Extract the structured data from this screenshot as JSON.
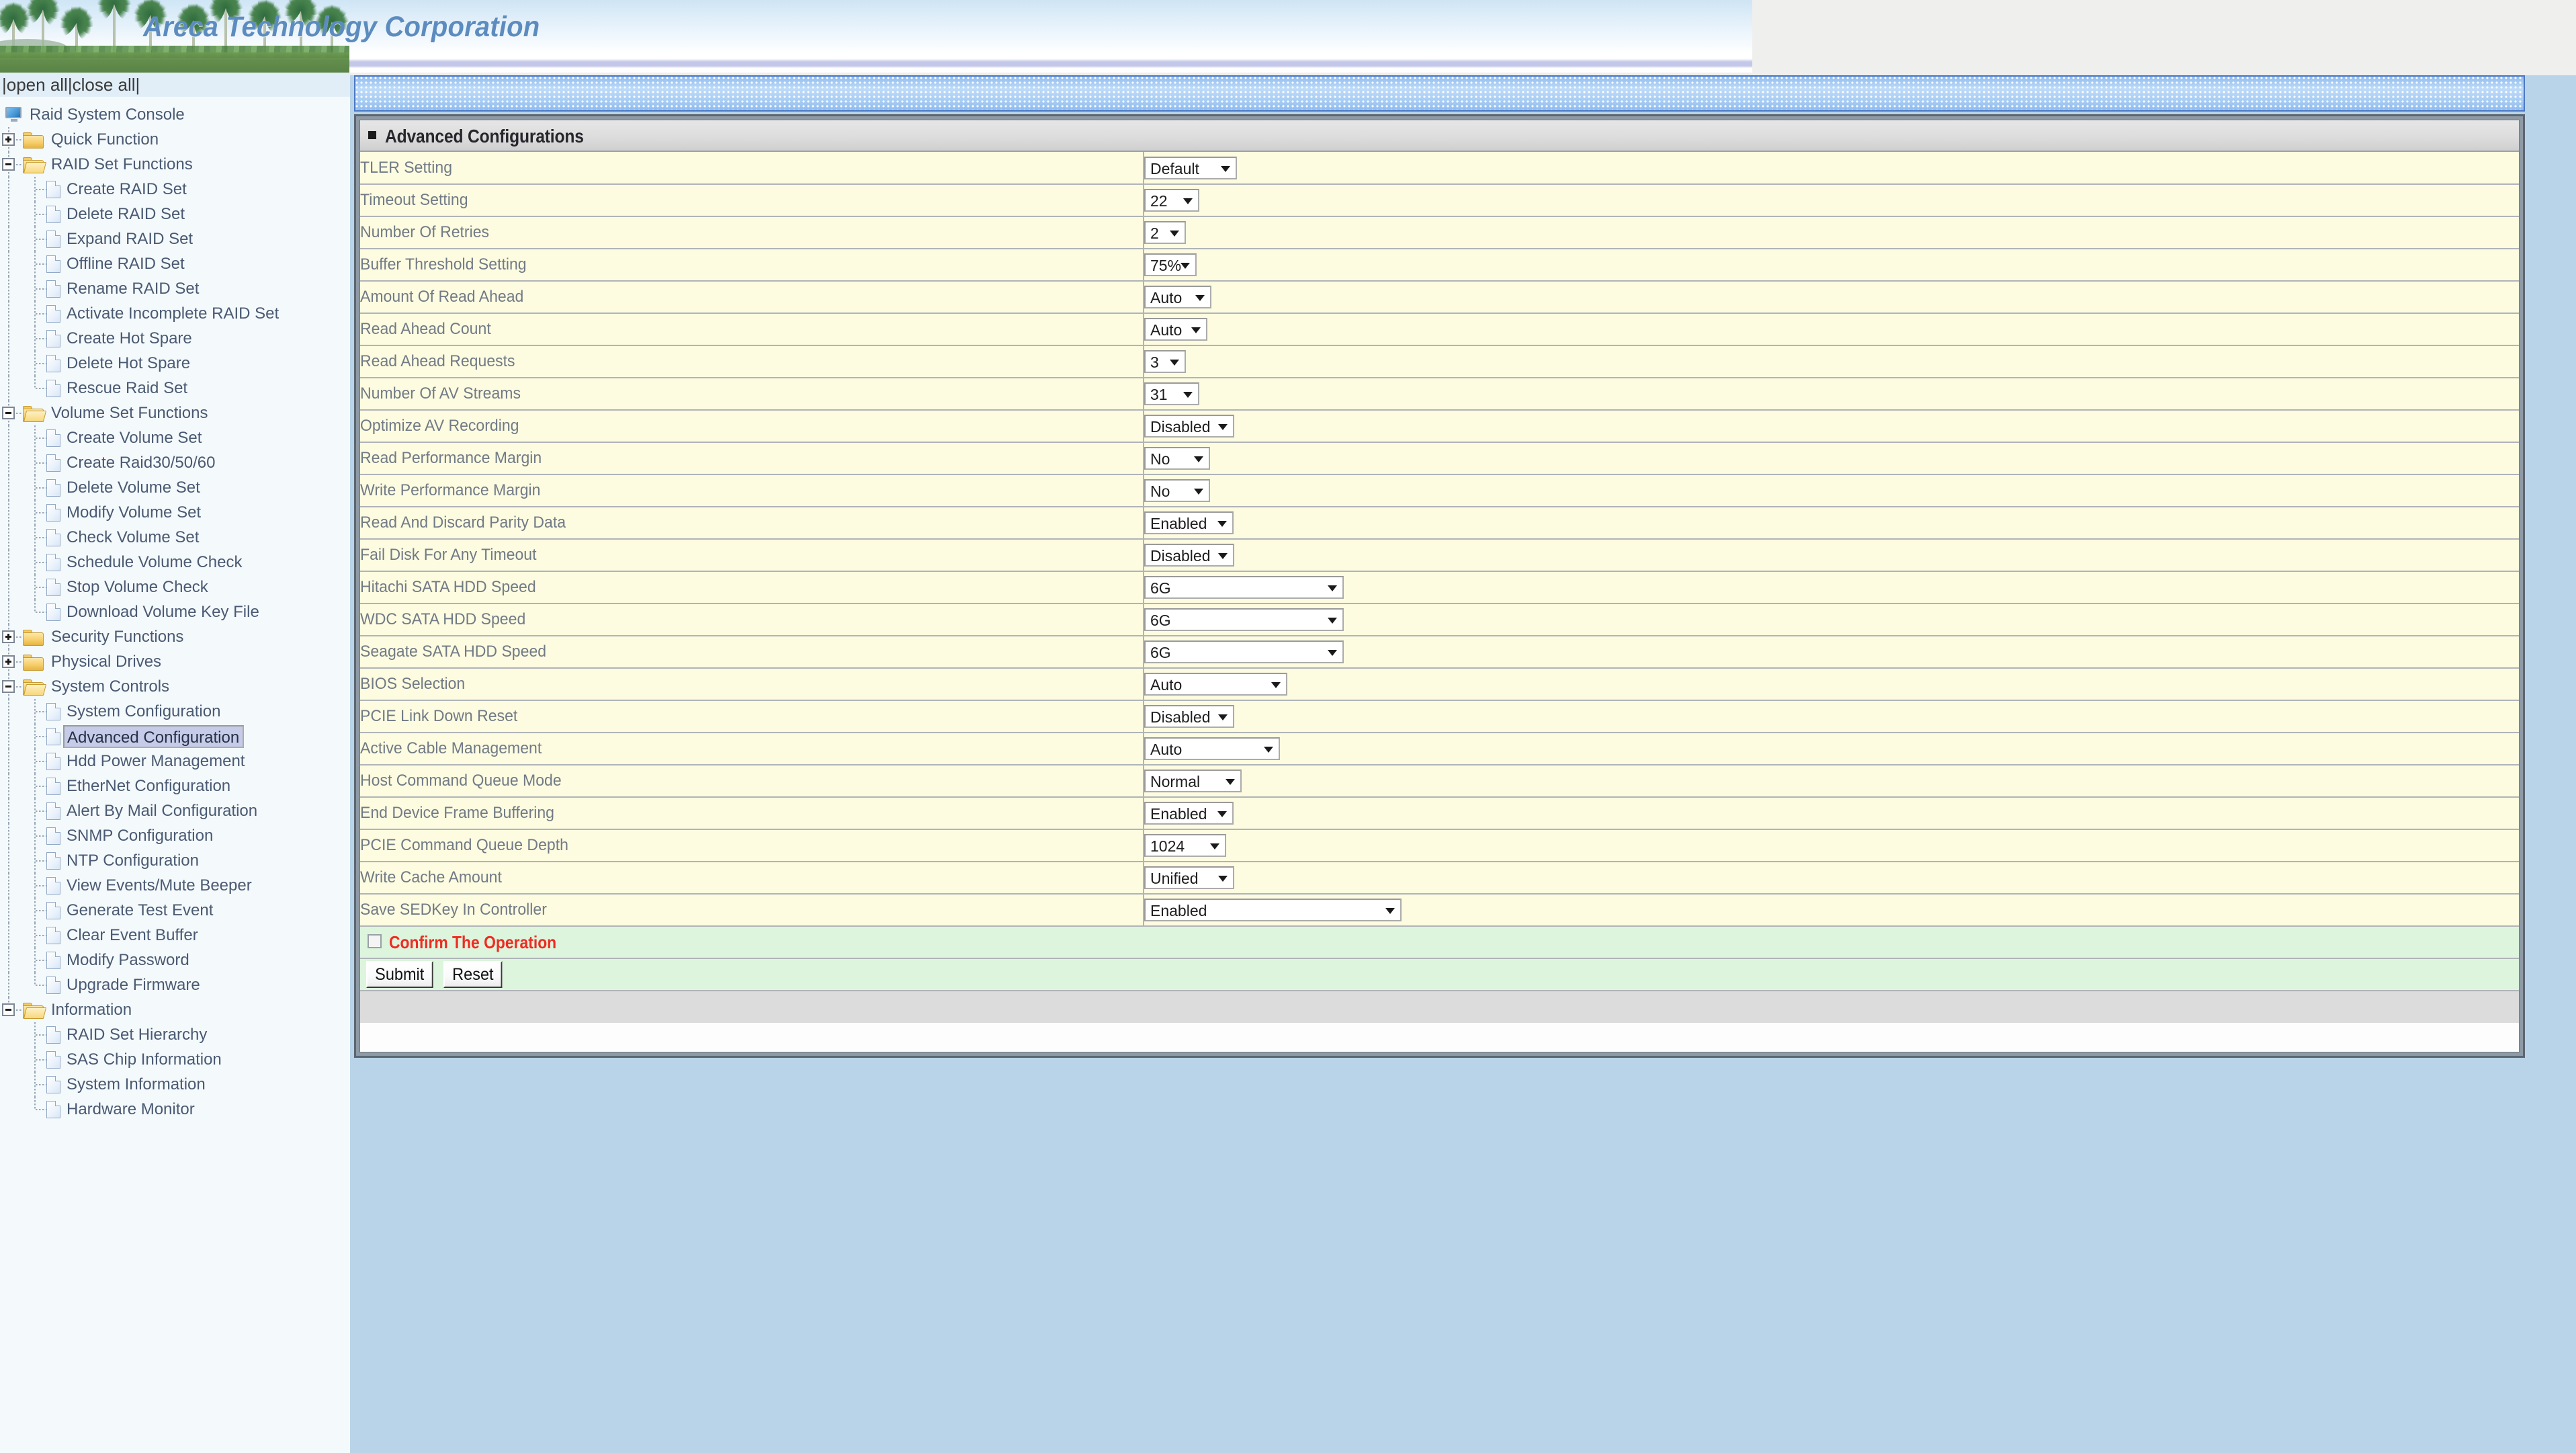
{
  "banner": {
    "title": "Areca Technology Corporation"
  },
  "sidebar": {
    "open_close": "|open all|close all|",
    "root": "Raid System Console",
    "groups": [
      {
        "label": "Quick Function",
        "state": "collapsed",
        "items": []
      },
      {
        "label": "RAID Set Functions",
        "state": "expanded",
        "items": [
          "Create RAID Set",
          "Delete RAID Set",
          "Expand RAID Set",
          "Offline RAID Set",
          "Rename RAID Set",
          "Activate Incomplete RAID Set",
          "Create Hot Spare",
          "Delete Hot Spare",
          "Rescue Raid Set"
        ]
      },
      {
        "label": "Volume Set Functions",
        "state": "expanded",
        "items": [
          "Create Volume Set",
          "Create Raid30/50/60",
          "Delete Volume Set",
          "Modify Volume Set",
          "Check Volume Set",
          "Schedule Volume Check",
          "Stop Volume Check",
          "Download Volume Key File"
        ]
      },
      {
        "label": "Security Functions",
        "state": "collapsed",
        "items": []
      },
      {
        "label": "Physical Drives",
        "state": "collapsed",
        "items": []
      },
      {
        "label": "System Controls",
        "state": "expanded",
        "items": [
          "System Configuration",
          "Advanced Configuration",
          "Hdd Power Management",
          "EtherNet Configuration",
          "Alert By Mail Configuration",
          "SNMP Configuration",
          "NTP Configuration",
          "View Events/Mute Beeper",
          "Generate Test Event",
          "Clear Event Buffer",
          "Modify Password",
          "Upgrade Firmware"
        ]
      },
      {
        "label": "Information",
        "state": "expanded",
        "items": [
          "RAID Set Hierarchy",
          "SAS Chip Information",
          "System Information",
          "Hardware Monitor"
        ]
      }
    ],
    "selected_item": "Advanced Configuration"
  },
  "panel": {
    "heading": "Advanced Configurations",
    "rows": [
      {
        "label": "TLER Setting",
        "value": "Default",
        "w": "w-default"
      },
      {
        "label": "Timeout Setting",
        "value": "22",
        "w": "w-22"
      },
      {
        "label": "Number Of Retries",
        "value": "2",
        "w": "w-2"
      },
      {
        "label": "Buffer Threshold Setting",
        "value": "75%",
        "w": "w-75"
      },
      {
        "label": "Amount Of Read Ahead",
        "value": "Auto",
        "w": "w-auto"
      },
      {
        "label": "Read Ahead Count",
        "value": "Auto",
        "w": "w-auto2"
      },
      {
        "label": "Read Ahead Requests",
        "value": "3",
        "w": "w-3"
      },
      {
        "label": "Number Of AV Streams",
        "value": "31",
        "w": "w-31"
      },
      {
        "label": "Optimize AV Recording",
        "value": "Disabled",
        "w": "w-disabled"
      },
      {
        "label": "Read Performance Margin",
        "value": "No",
        "w": "w-no"
      },
      {
        "label": "Write Performance Margin",
        "value": "No",
        "w": "w-no"
      },
      {
        "label": "Read And Discard Parity Data",
        "value": "Enabled",
        "w": "w-enabled"
      },
      {
        "label": "Fail Disk For Any Timeout",
        "value": "Disabled",
        "w": "w-disabled"
      },
      {
        "label": "Hitachi SATA HDD Speed",
        "value": "6G",
        "w": "w-6g"
      },
      {
        "label": "WDC SATA HDD Speed",
        "value": "6G",
        "w": "w-6g"
      },
      {
        "label": "Seagate SATA HDD Speed",
        "value": "6G",
        "w": "w-6g"
      },
      {
        "label": "BIOS Selection",
        "value": "Auto",
        "w": "w-bios"
      },
      {
        "label": "PCIE Link Down Reset",
        "value": "Disabled",
        "w": "w-disabled"
      },
      {
        "label": "Active Cable Management",
        "value": "Auto",
        "w": "w-acm"
      },
      {
        "label": "Host Command Queue Mode",
        "value": "Normal",
        "w": "w-normal"
      },
      {
        "label": "End Device Frame Buffering",
        "value": "Enabled",
        "w": "w-enabled"
      },
      {
        "label": "PCIE Command Queue Depth",
        "value": "1024",
        "w": "w-1024"
      },
      {
        "label": "Write Cache Amount",
        "value": "Unified",
        "w": "w-unified"
      },
      {
        "label": "Save SEDKey In Controller",
        "value": "Enabled",
        "w": "w-sedkey"
      }
    ],
    "confirm_label": "Confirm The Operation",
    "confirm_checked": false,
    "submit_label": "Submit",
    "reset_label": "Reset"
  },
  "colors": {
    "title": "#5c8cbf",
    "row_bg": "#fdfbe0",
    "confirm_bg": "#ddf5dd",
    "confirm_text": "#ef2b22",
    "page_bg": "#b9d4e8",
    "sidebar_bg": "#f4f9fc",
    "selection": "#c5cbe8"
  }
}
